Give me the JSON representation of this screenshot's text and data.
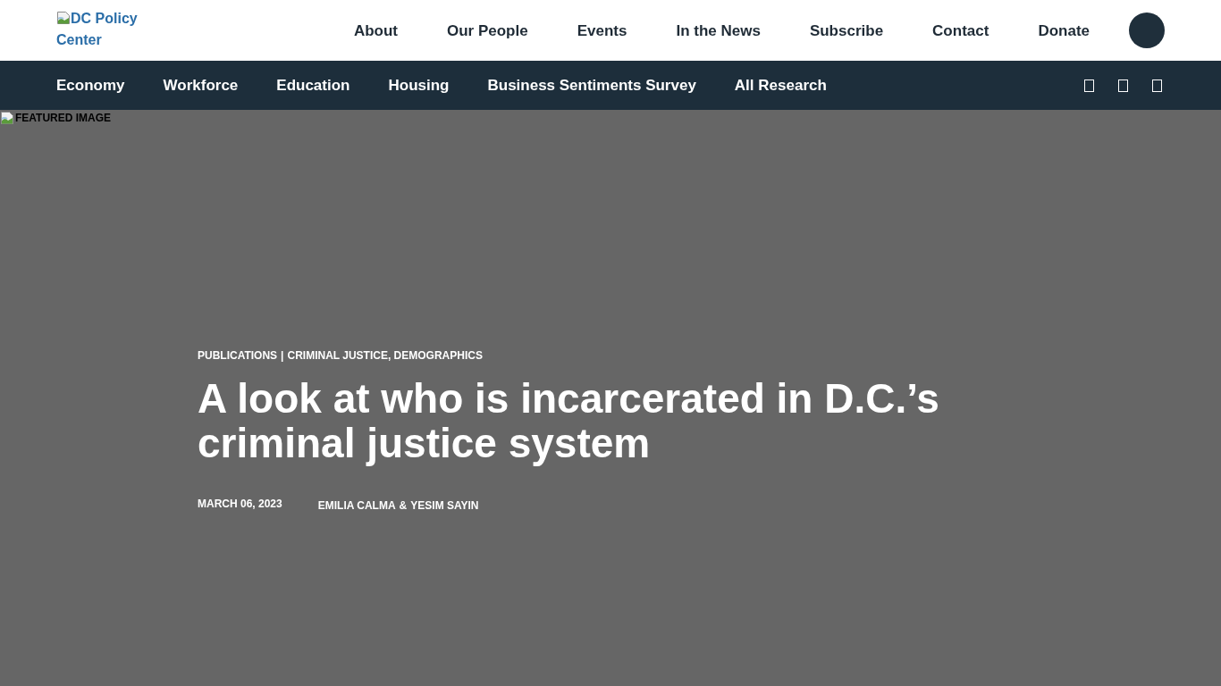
{
  "header": {
    "logo": {
      "alt_text": "DC Policy Center"
    },
    "menu": [
      "About",
      "Our People",
      "Events",
      "In the News",
      "Subscribe",
      "Contact",
      "Donate"
    ]
  },
  "section_nav": {
    "items": [
      "Economy",
      "Workforce",
      "Education",
      "Housing",
      "Business Sentiments Survey",
      "All Research"
    ]
  },
  "hero": {
    "featured_image": {
      "alt_text": "FEATURED IMAGE"
    },
    "section": "PUBLICATIONS",
    "separator": "|",
    "categories": "CRIMINAL JUSTICE, DEMOGRAPHICS",
    "title": "A look at who is incarcerated in D.C.’s criminal justice system",
    "date": "MARCH 06, 2023",
    "authors": [
      "EMILIA CALMA",
      "YESIM SAYIN"
    ],
    "author_joiner": "&"
  }
}
